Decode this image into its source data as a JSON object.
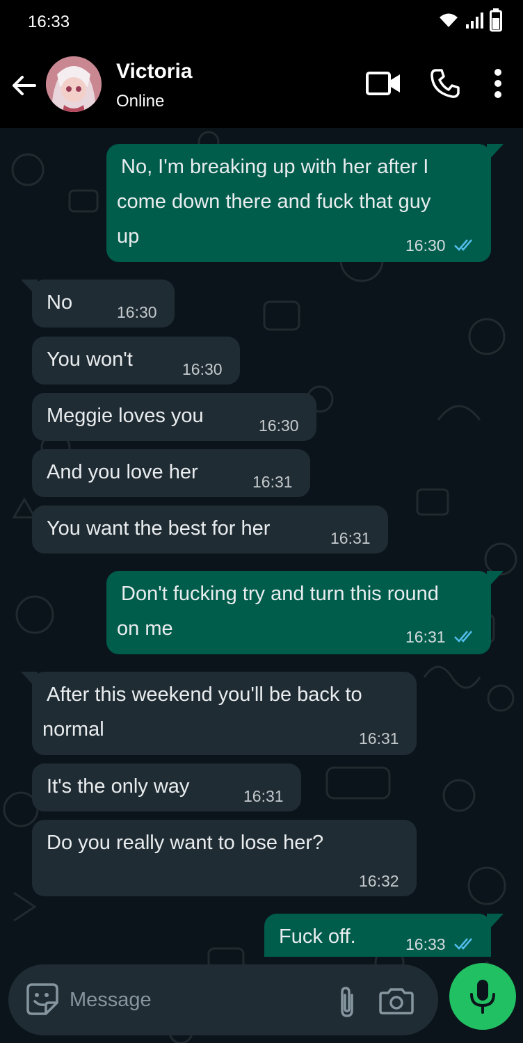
{
  "status_bar": {
    "time": "16:33",
    "icons": [
      "wifi-icon",
      "signal-icon",
      "battery-icon"
    ]
  },
  "header": {
    "contact_name": "Victoria",
    "contact_status": "Online",
    "icons": [
      "back-arrow-icon",
      "video-call-icon",
      "voice-call-icon",
      "more-options-icon"
    ]
  },
  "messages": [
    {
      "direction": "outgoing",
      "lines": [
        "No, I'm breaking up with her after I",
        "come down there and fuck that guy",
        "up"
      ],
      "time": "16:30",
      "status": "read"
    },
    {
      "direction": "incoming",
      "lines": [
        "No"
      ],
      "time": "16:30"
    },
    {
      "direction": "incoming",
      "lines": [
        "You won't"
      ],
      "time": "16:30"
    },
    {
      "direction": "incoming",
      "lines": [
        "Meggie loves you"
      ],
      "time": "16:30"
    },
    {
      "direction": "incoming",
      "lines": [
        "And you love her"
      ],
      "time": "16:31"
    },
    {
      "direction": "incoming",
      "lines": [
        "You want the best for her"
      ],
      "time": "16:31"
    },
    {
      "direction": "outgoing",
      "lines": [
        "Don't fucking try and turn this round",
        "on me"
      ],
      "time": "16:31",
      "status": "read"
    },
    {
      "direction": "incoming",
      "lines": [
        "After this weekend you'll be back to",
        "normal"
      ],
      "time": "16:31"
    },
    {
      "direction": "incoming",
      "lines": [
        "It's the only way"
      ],
      "time": "16:31"
    },
    {
      "direction": "incoming",
      "lines": [
        "Do you really want to lose her?"
      ],
      "time": "16:32"
    },
    {
      "direction": "outgoing",
      "lines": [
        "Fuck off."
      ],
      "time": "16:33",
      "status": "read"
    }
  ],
  "composer": {
    "placeholder": "Message",
    "icons": [
      "sticker-icon",
      "attach-icon",
      "camera-icon",
      "microphone-icon"
    ]
  },
  "colors": {
    "background": "#0b141a",
    "outgoing_bubble": "#005c4b",
    "incoming_bubble": "#202c33",
    "read_tick": "#53bdeb",
    "mic_button": "#21c063"
  }
}
